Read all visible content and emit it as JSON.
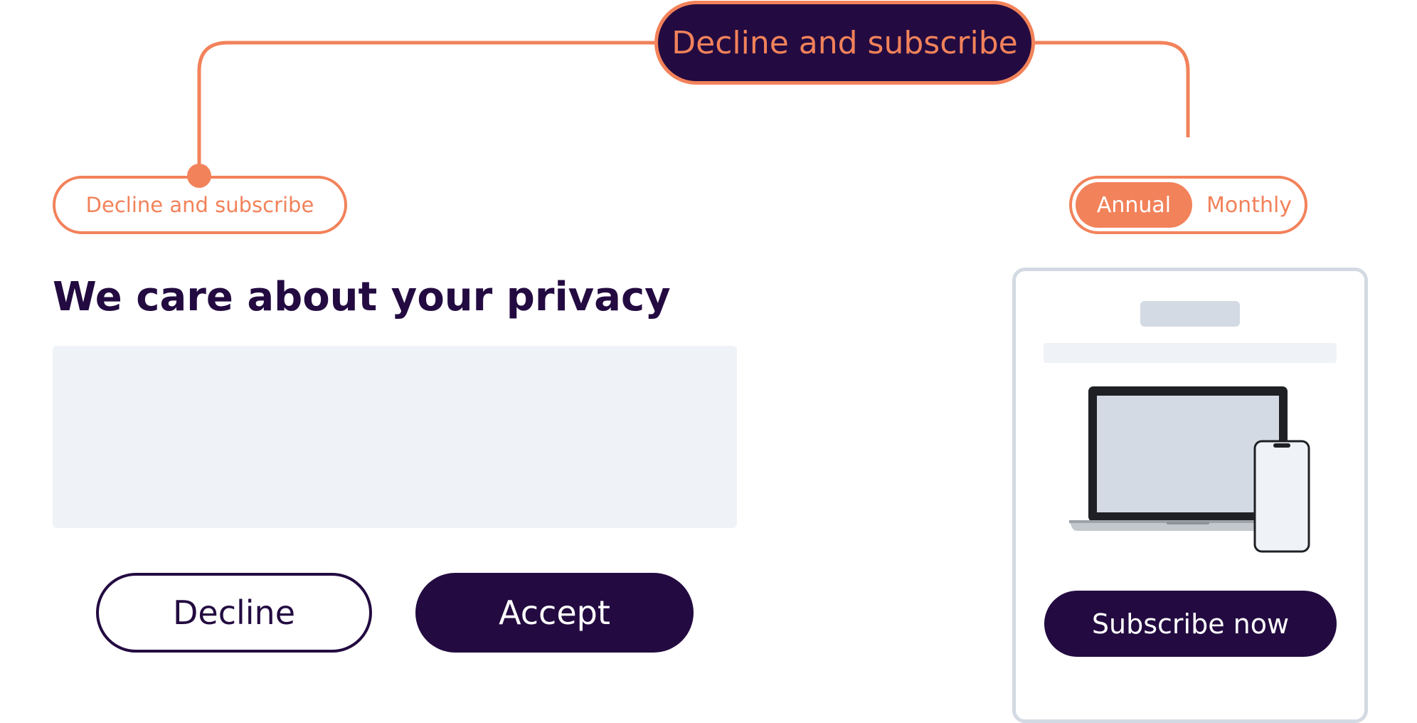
{
  "colors": {
    "accent": "#f2825a",
    "brand_dark": "#230b41",
    "placeholder_light": "#eff2f6",
    "placeholder_mid": "#d3dae3"
  },
  "top_label": "Decline and subscribe",
  "left_option": {
    "label": "Decline and subscribe"
  },
  "billing_toggle": {
    "options": [
      "Annual",
      "Monthly"
    ],
    "selected": "Annual"
  },
  "consent": {
    "heading": "We care about your privacy",
    "decline_label": "Decline",
    "accept_label": "Accept"
  },
  "subscription_card": {
    "icons": [
      "laptop-icon",
      "phone-icon"
    ],
    "subscribe_label": "Subscribe now"
  }
}
